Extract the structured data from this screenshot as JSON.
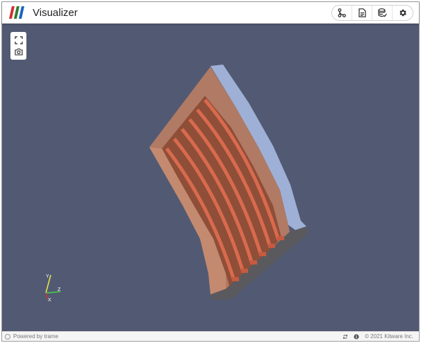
{
  "app": {
    "title": "Visualizer",
    "logo_icon": "trame-logo-icon",
    "logo_colors": [
      "#d32f2f",
      "#1b5e20",
      "#1565c0"
    ]
  },
  "toolbar": {
    "buttons": [
      {
        "name": "pipeline-button",
        "icon": "graph-branch-icon"
      },
      {
        "name": "file-button",
        "icon": "file-document-icon"
      },
      {
        "name": "data-button",
        "icon": "database-check-icon"
      },
      {
        "name": "settings-button",
        "icon": "gear-icon"
      }
    ]
  },
  "view_tools": [
    {
      "name": "reset-camera-button",
      "icon": "fullscreen-corners-icon"
    },
    {
      "name": "screenshot-button",
      "icon": "camera-icon"
    }
  ],
  "scene": {
    "background": "#525a73",
    "object": "curved-plate-with-fins",
    "fin_count": 7,
    "colors": {
      "body": "#b07a64",
      "fins": "#d96a4e",
      "face": "#9fb0d6",
      "shadow": "#5a5a5e"
    }
  },
  "axes": {
    "x": "X",
    "y": "Y",
    "z": "Z"
  },
  "footer": {
    "powered_by": "Powered by trame",
    "copyright": "© 2021 Kitware Inc.",
    "icons": [
      "sync-icon",
      "info-icon"
    ]
  }
}
